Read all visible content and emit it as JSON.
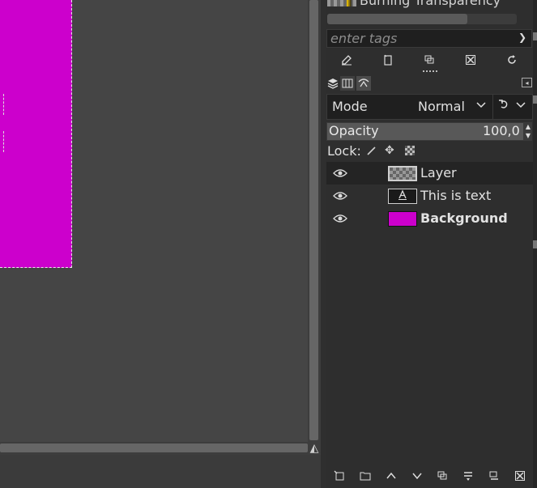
{
  "brushes": {
    "current_name": "Burning Transparency",
    "progress_fraction": 0.74,
    "tags_placeholder": "enter tags",
    "actions": [
      "edit-brush-icon",
      "new-brush-icon",
      "duplicate-brush-icon",
      "delete-brush-icon",
      "refresh-brushes-icon"
    ]
  },
  "layers_panel": {
    "tabs": [
      "layers-tab-icon",
      "channels-tab-icon",
      "paths-tab-icon"
    ],
    "mode_label": "Mode",
    "mode_value": "Normal",
    "opacity_label": "Opacity",
    "opacity_value": "100,0",
    "lock_label": "Lock:",
    "layers": [
      {
        "name": "Layer",
        "thumb": "transparent",
        "visible": true,
        "selected": true,
        "bold": false
      },
      {
        "name": "This is text",
        "thumb": "text",
        "visible": true,
        "selected": false,
        "bold": false
      },
      {
        "name": "Background",
        "thumb": "magenta",
        "visible": true,
        "selected": false,
        "bold": true
      }
    ],
    "actions": [
      "new-layer-icon",
      "new-layer-group-icon",
      "raise-layer-icon",
      "lower-layer-icon",
      "duplicate-layer-icon",
      "merge-down-icon",
      "mask-icon",
      "delete-layer-icon"
    ]
  },
  "colors": {
    "image_fill": "#cc00cc",
    "canvas_bg": "#454545",
    "dock_bg": "#2e2e2e"
  }
}
